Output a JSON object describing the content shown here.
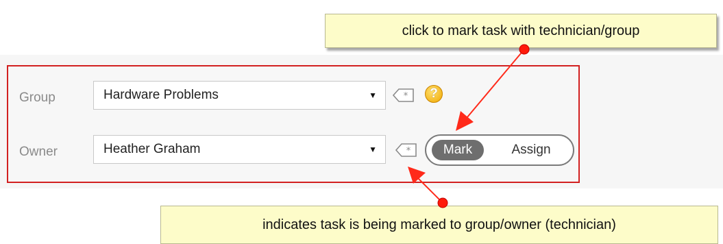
{
  "form": {
    "group": {
      "label": "Group",
      "value": "Hardware Problems",
      "arrow": "▼",
      "help": "?"
    },
    "owner": {
      "label": "Owner",
      "value": "Heather Graham",
      "arrow": "▼"
    },
    "toggle": {
      "mark_label": "Mark",
      "assign_label": "Assign",
      "selected": "Mark"
    }
  },
  "annotations": {
    "top_callout": "click to mark task with technician/group",
    "bottom_callout": "indicates task is being marked to group/owner (technician)"
  },
  "colors": {
    "frame_border": "#d22020",
    "arrow": "#ff2a1a",
    "callout_bg": "#fdfcc9",
    "toggle_selected_bg": "#6e6e6e",
    "help_icon": "#f0a800"
  }
}
